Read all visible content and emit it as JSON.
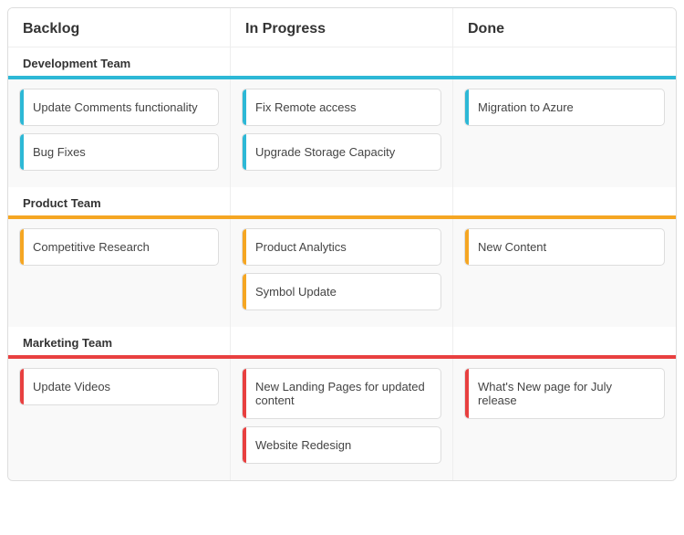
{
  "columns": {
    "backlog": "Backlog",
    "inProgress": "In Progress",
    "done": "Done"
  },
  "teams": [
    {
      "name": "Development Team",
      "color": "dev",
      "backlog": [
        "Update Comments functionality",
        "Bug Fixes"
      ],
      "inProgress": [
        "Fix  Remote access",
        "Upgrade Storage Capacity"
      ],
      "done": [
        "Migration to Azure"
      ]
    },
    {
      "name": "Product Team",
      "color": "prod",
      "backlog": [
        "Competitive Research"
      ],
      "inProgress": [
        "Product  Analytics",
        "Symbol Update"
      ],
      "done": [
        "New Content"
      ]
    },
    {
      "name": "Marketing Team",
      "color": "mkt",
      "backlog": [
        "Update Videos"
      ],
      "inProgress": [
        "New Landing Pages for updated content",
        "Website  Redesign"
      ],
      "done": [
        "What's New page for July release"
      ]
    }
  ]
}
